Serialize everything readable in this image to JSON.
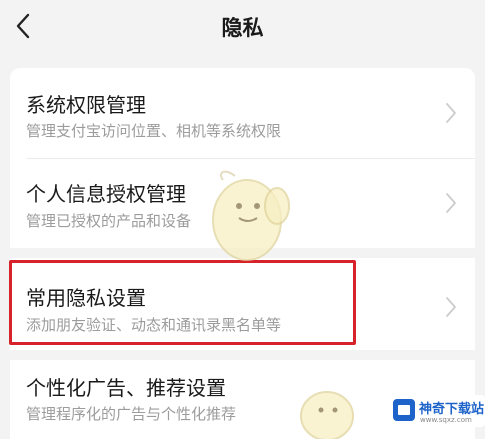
{
  "header": {
    "title": "隐私",
    "back_icon": "chevron-left-icon"
  },
  "items": [
    {
      "title": "系统权限管理",
      "desc": "管理支付宝访问位置、相机等系统权限"
    },
    {
      "title": "个人信息授权管理",
      "desc": "管理已授权的产品和设备"
    },
    {
      "title": "常用隐私设置",
      "desc": "添加朋友验证、动态和通讯录黑名单等",
      "highlighted": true
    },
    {
      "title": "个性化广告、推荐设置",
      "desc": "管理程序化的广告与个性化推荐"
    }
  ],
  "watermark": {
    "name": "神奇下载站",
    "url": "www.sqxz.com",
    "icon": "watermark-logo-icon"
  },
  "colors": {
    "background": "#f3f3f3",
    "card": "#ffffff",
    "highlight": "#d6232b",
    "title_text": "#1a1a1a",
    "desc_text": "#9c9c9c"
  }
}
